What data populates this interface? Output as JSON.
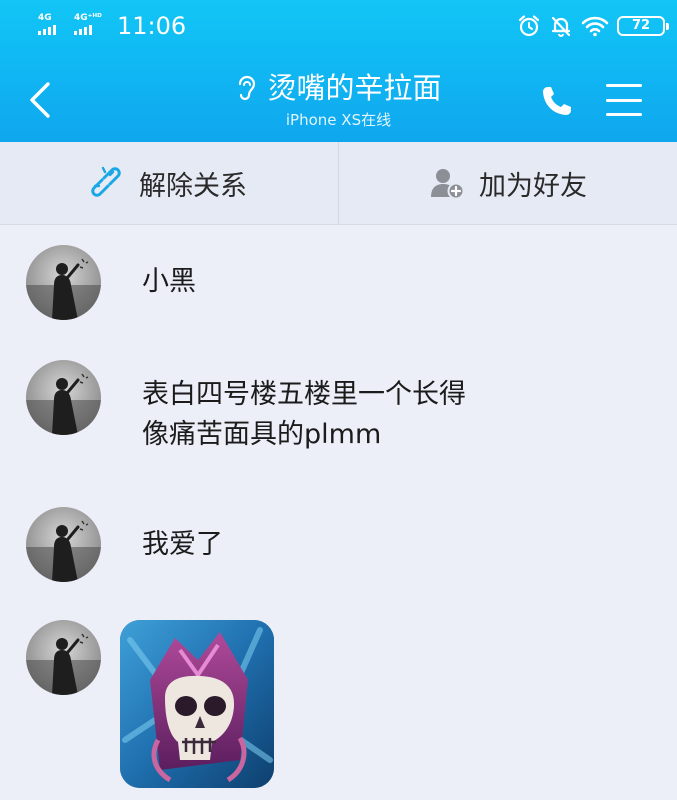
{
  "status_bar": {
    "net_1": "4G",
    "net_2": "4G⁺ᴴᴰ",
    "time": "11:06",
    "battery_level": "72",
    "icons": [
      "alarm-icon",
      "mute-bell-icon",
      "wifi-icon",
      "battery-icon"
    ]
  },
  "header": {
    "title": "烫嘴的辛拉面",
    "subtitle": "iPhone XS在线",
    "icons": [
      "back-chevron-icon",
      "ear-icon",
      "phone-icon",
      "menu-icon"
    ]
  },
  "actions": {
    "unlink_label": "解除关系",
    "add_friend_label": "加为好友",
    "icons": [
      "broken-link-icon",
      "add-friend-icon"
    ]
  },
  "messages": [
    {
      "type": "text",
      "text": "小黑"
    },
    {
      "type": "text",
      "text": "表白四号楼五楼里一个长得\n像痛苦面具的plmm"
    },
    {
      "type": "text",
      "text": "我爱了"
    },
    {
      "type": "image",
      "content": "skull-mask-sticker"
    }
  ],
  "colors": {
    "header_blue": "#10b8f3",
    "accent_cyan": "#1aa7e6",
    "background": "#eceff8"
  }
}
